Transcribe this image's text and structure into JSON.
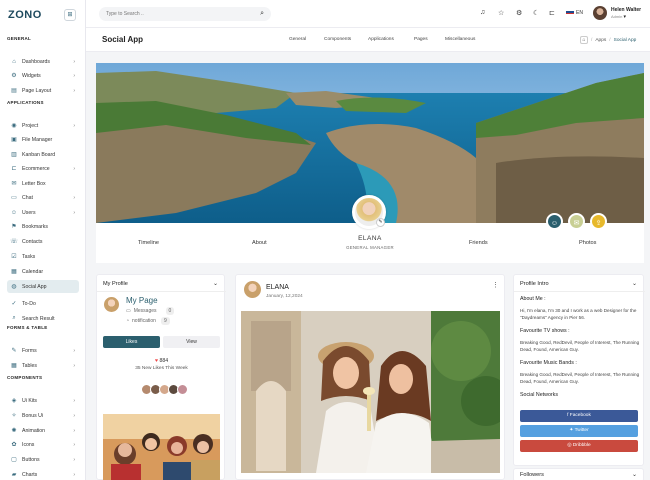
{
  "app": {
    "logo": "ZONO"
  },
  "sidebar": {
    "sections": {
      "general": "GENERAL",
      "applications": "APPLICATIONS",
      "forms": "FORMS & TABLE",
      "components": "COMPONENTS"
    },
    "items": [
      {
        "label": "Dashboards",
        "icon": "home-icon",
        "chev": "›"
      },
      {
        "label": "Widgets",
        "icon": "widgets-icon",
        "chev": "›"
      },
      {
        "label": "Page Layout",
        "icon": "layout-icon",
        "chev": "›"
      },
      {
        "label": "Project",
        "icon": "project-icon",
        "chev": "›"
      },
      {
        "label": "File Manager",
        "icon": "file-icon",
        "chev": ""
      },
      {
        "label": "Kanban Board",
        "icon": "kanban-icon",
        "chev": ""
      },
      {
        "label": "Ecommerce",
        "icon": "cart-icon",
        "chev": "›"
      },
      {
        "label": "Letter Box",
        "icon": "mail-icon",
        "chev": ""
      },
      {
        "label": "Chat",
        "icon": "chat-icon",
        "chev": "›"
      },
      {
        "label": "Users",
        "icon": "users-icon",
        "chev": "›"
      },
      {
        "label": "Bookmarks",
        "icon": "bookmark-icon",
        "chev": ""
      },
      {
        "label": "Contacts",
        "icon": "contacts-icon",
        "chev": ""
      },
      {
        "label": "Tasks",
        "icon": "tasks-icon",
        "chev": ""
      },
      {
        "label": "Calendar",
        "icon": "calendar-icon",
        "chev": ""
      },
      {
        "label": "Social App",
        "icon": "social-icon",
        "chev": ""
      },
      {
        "label": "To-Do",
        "icon": "todo-icon",
        "chev": ""
      },
      {
        "label": "Search Result",
        "icon": "search-icon",
        "chev": ""
      },
      {
        "label": "Forms",
        "icon": "forms-icon",
        "chev": "›"
      },
      {
        "label": "Tables",
        "icon": "tables-icon",
        "chev": "›"
      },
      {
        "label": "Ui Kits",
        "icon": "uikit-icon",
        "chev": "›"
      },
      {
        "label": "Bonus Ui",
        "icon": "bonus-icon",
        "chev": "›"
      },
      {
        "label": "Animation",
        "icon": "animation-icon",
        "chev": "›"
      },
      {
        "label": "Icons",
        "icon": "icons-icon",
        "chev": "›"
      },
      {
        "label": "Buttons",
        "icon": "buttons-icon",
        "chev": "›"
      },
      {
        "label": "Charts",
        "icon": "charts-icon",
        "chev": "›"
      }
    ]
  },
  "topbar": {
    "search_placeholder": "Type to Search ..",
    "language": "EN",
    "user_name": "Helen Walter",
    "user_role": "Admin"
  },
  "header": {
    "title": "Social App",
    "nav": [
      "General",
      "Components",
      "Applications",
      "Pages",
      "Miscellaneous"
    ],
    "breadcrumb": {
      "apps": "Apps",
      "sep": "/",
      "current": "Social App"
    }
  },
  "profile": {
    "name": "ELANA",
    "role": "GENERAL MANAGER",
    "tabs": [
      "Timeline",
      "About",
      "Friends",
      "Photos"
    ]
  },
  "my_profile": {
    "title": "My Profile",
    "name": "My Page",
    "messages_label": "Messages",
    "messages_count": "0",
    "notification_label": "notification",
    "notification_count": "9",
    "likes_button": "Likes",
    "view_button": "View",
    "likes_count": "884",
    "likes_text": "35 New Likes This Week"
  },
  "post": {
    "author": "ELANA",
    "date": "January, 12,2024"
  },
  "intro": {
    "title": "Profile Intro",
    "about_label": "About Me :",
    "about_text": "Hi, I'm elana, I'm 30 and I work as a web Designer for the \"Daydreams\" Agency in Pier 56.",
    "tv_label": "Favourite TV shows :",
    "tv_text": "Breaking Good, RedDevil, People of Interest, The Running Dead, Found, American Guy.",
    "music_label": "Favourite Music Bands :",
    "music_text": "Breaking Good, RedDevil, People of Interest, The Running Dead, Found, American Guy.",
    "social_label": "Social Networks",
    "facebook": "f Facebook",
    "twitter": "Twitter",
    "dribbble": "Dribbble",
    "followers_title": "Followers"
  },
  "colors": {
    "primary": "#2b5f6e",
    "facebook": "#3b5998",
    "twitter": "#55a0e0",
    "dribbble": "#c94a3e",
    "heart": "#e44"
  }
}
